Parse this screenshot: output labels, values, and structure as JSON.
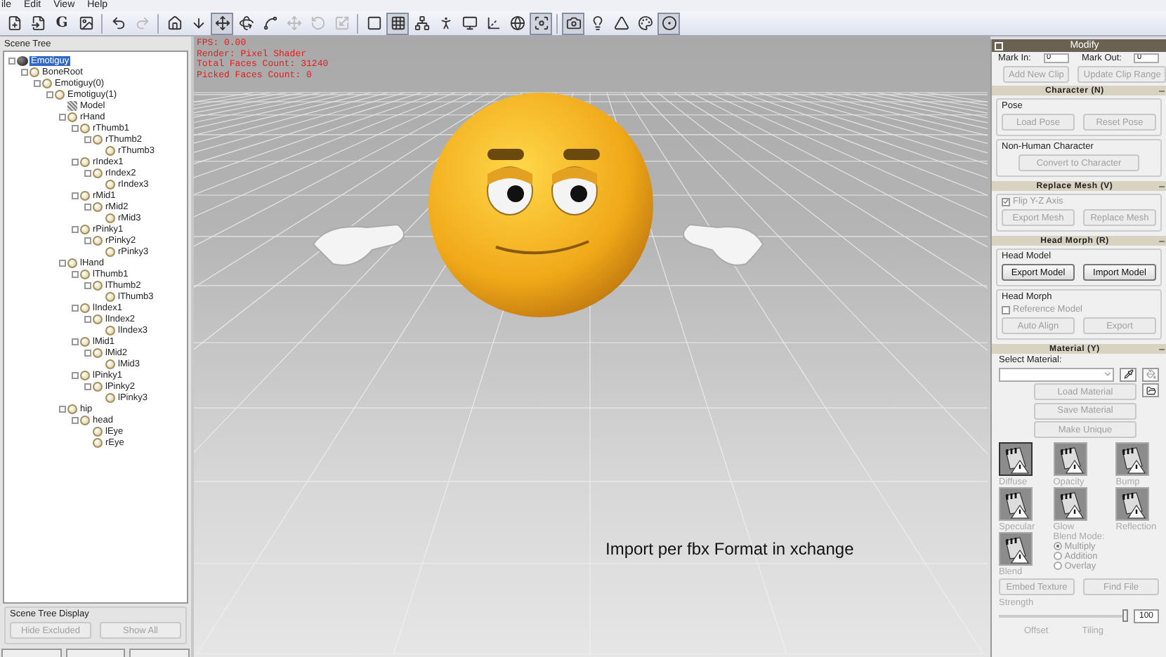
{
  "menu": [
    "ile",
    "Edit",
    "View",
    "Help"
  ],
  "toolbar": [
    {
      "kind": "new",
      "selected": false,
      "disabled": false
    },
    {
      "kind": "open",
      "selected": false,
      "disabled": false
    },
    {
      "kind": "text",
      "label": "G",
      "selected": false,
      "disabled": false
    },
    {
      "kind": "image",
      "selected": false,
      "disabled": false
    },
    {
      "kind": "sep"
    },
    {
      "kind": "undo",
      "selected": false,
      "disabled": false
    },
    {
      "kind": "redo",
      "selected": false,
      "disabled": true
    },
    {
      "kind": "sep"
    },
    {
      "kind": "home",
      "selected": false,
      "disabled": false
    },
    {
      "kind": "down",
      "selected": false,
      "disabled": false
    },
    {
      "kind": "move",
      "selected": true,
      "disabled": false
    },
    {
      "kind": "rotate",
      "selected": false,
      "disabled": false
    },
    {
      "kind": "bend",
      "selected": false,
      "disabled": false
    },
    {
      "kind": "move",
      "selected": false,
      "disabled": true
    },
    {
      "kind": "reset",
      "selected": false,
      "disabled": true
    },
    {
      "kind": "scale",
      "selected": false,
      "disabled": true
    },
    {
      "kind": "sep"
    },
    {
      "kind": "square",
      "selected": false,
      "disabled": false
    },
    {
      "kind": "grid",
      "selected": true,
      "disabled": false
    },
    {
      "kind": "bones",
      "selected": false,
      "disabled": false
    },
    {
      "kind": "figure",
      "selected": false,
      "disabled": false
    },
    {
      "kind": "screen",
      "selected": false,
      "disabled": false
    },
    {
      "kind": "axis",
      "selected": false,
      "disabled": false
    },
    {
      "kind": "globe",
      "selected": false,
      "disabled": false
    },
    {
      "kind": "focus",
      "selected": true,
      "disabled": false
    },
    {
      "kind": "sep"
    },
    {
      "kind": "camera",
      "selected": true,
      "disabled": false
    },
    {
      "kind": "light",
      "selected": false,
      "disabled": false
    },
    {
      "kind": "pyramid",
      "selected": false,
      "disabled": false
    },
    {
      "kind": "color",
      "selected": false,
      "disabled": false
    },
    {
      "kind": "sphere",
      "selected": true,
      "disabled": false
    }
  ],
  "scene_tree": {
    "title": "Scene Tree",
    "items": [
      {
        "label": "Emotiguy",
        "kind": "root",
        "selected": true,
        "children": [
          {
            "label": "BoneRoot",
            "kind": "node",
            "selected": false,
            "children": [
              {
                "label": "Emotiguy(0)",
                "kind": "node",
                "selected": false,
                "children": [
                  {
                    "label": "Emotiguy(1)",
                    "kind": "node",
                    "selected": false,
                    "children": [
                      {
                        "label": "Model",
                        "kind": "model",
                        "selected": false
                      },
                      {
                        "label": "rHand",
                        "kind": "node",
                        "selected": false,
                        "children": [
                          {
                            "label": "rThumb1",
                            "kind": "node",
                            "selected": false,
                            "children": [
                              {
                                "label": "rThumb2",
                                "kind": "node",
                                "selected": false,
                                "children": [
                                  {
                                    "label": "rThumb3",
                                    "kind": "node",
                                    "selected": false
                                  }
                                ]
                              }
                            ]
                          },
                          {
                            "label": "rIndex1",
                            "kind": "node",
                            "selected": false,
                            "children": [
                              {
                                "label": "rIndex2",
                                "kind": "node",
                                "selected": false,
                                "children": [
                                  {
                                    "label": "rIndex3",
                                    "kind": "node",
                                    "selected": false
                                  }
                                ]
                              }
                            ]
                          },
                          {
                            "label": "rMid1",
                            "kind": "node",
                            "selected": false,
                            "children": [
                              {
                                "label": "rMid2",
                                "kind": "node",
                                "selected": false,
                                "children": [
                                  {
                                    "label": "rMid3",
                                    "kind": "node",
                                    "selected": false
                                  }
                                ]
                              }
                            ]
                          },
                          {
                            "label": "rPinky1",
                            "kind": "node",
                            "selected": false,
                            "children": [
                              {
                                "label": "rPinky2",
                                "kind": "node",
                                "selected": false,
                                "children": [
                                  {
                                    "label": "rPinky3",
                                    "kind": "node",
                                    "selected": false
                                  }
                                ]
                              }
                            ]
                          }
                        ]
                      },
                      {
                        "label": "lHand",
                        "kind": "node",
                        "selected": false,
                        "children": [
                          {
                            "label": "lThumb1",
                            "kind": "node",
                            "selected": false,
                            "children": [
                              {
                                "label": "lThumb2",
                                "kind": "node",
                                "selected": false,
                                "children": [
                                  {
                                    "label": "lThumb3",
                                    "kind": "node",
                                    "selected": false
                                  }
                                ]
                              }
                            ]
                          },
                          {
                            "label": "lIndex1",
                            "kind": "node",
                            "selected": false,
                            "children": [
                              {
                                "label": "lIndex2",
                                "kind": "node",
                                "selected": false,
                                "children": [
                                  {
                                    "label": "lIndex3",
                                    "kind": "node",
                                    "selected": false
                                  }
                                ]
                              }
                            ]
                          },
                          {
                            "label": "lMid1",
                            "kind": "node",
                            "selected": false,
                            "children": [
                              {
                                "label": "lMid2",
                                "kind": "node",
                                "selected": false,
                                "children": [
                                  {
                                    "label": "lMid3",
                                    "kind": "node",
                                    "selected": false
                                  }
                                ]
                              }
                            ]
                          },
                          {
                            "label": "lPinky1",
                            "kind": "node",
                            "selected": false,
                            "children": [
                              {
                                "label": "lPinky2",
                                "kind": "node",
                                "selected": false,
                                "children": [
                                  {
                                    "label": "lPinky3",
                                    "kind": "node",
                                    "selected": false
                                  }
                                ]
                              }
                            ]
                          }
                        ]
                      },
                      {
                        "label": "hip",
                        "kind": "node",
                        "selected": false,
                        "children": [
                          {
                            "label": "head",
                            "kind": "node",
                            "selected": false,
                            "children": [
                              {
                                "label": "lEye",
                                "kind": "node",
                                "selected": false
                              },
                              {
                                "label": "rEye",
                                "kind": "node",
                                "selected": false
                              }
                            ]
                          }
                        ]
                      }
                    ]
                  }
                ]
              }
            ]
          }
        ]
      }
    ]
  },
  "scene_tree_display": {
    "title": "Scene Tree Display",
    "buttons": [
      {
        "label": "Hide Excluded",
        "disabled": true
      },
      {
        "label": "Show All",
        "disabled": true
      }
    ]
  },
  "viewport": {
    "stats": [
      "FPS: 0.00",
      "Render: Pixel Shader",
      "Total Faces Count: 31240",
      "Picked Faces Count: 0"
    ],
    "caption": "Import per fbx Format in xchange"
  },
  "modify": {
    "title": "Modify",
    "mark_in": {
      "label": "Mark In:",
      "value": "0"
    },
    "mark_out": {
      "label": "Mark Out:",
      "value": "0"
    },
    "clip_buttons": [
      {
        "label": "Add New Clip",
        "disabled": true
      },
      {
        "label": "Update Clip Range",
        "disabled": true
      }
    ],
    "sections": [
      {
        "title": "Character (N)",
        "groups": [
          {
            "title": "Pose",
            "rows": [
              {
                "kind": "buttons",
                "buttons": [
                  {
                    "label": "Load Pose",
                    "disabled": true
                  },
                  {
                    "label": "Reset Pose",
                    "disabled": true
                  }
                ]
              }
            ]
          },
          {
            "title": "Non-Human Character",
            "rows": [
              {
                "kind": "wide",
                "buttons": [
                  {
                    "label": "Convert to Character",
                    "disabled": true
                  }
                ]
              }
            ]
          }
        ]
      },
      {
        "title": "Replace Mesh (V)",
        "groups": [
          {
            "rows": [
              {
                "kind": "checkbox",
                "label": "Flip Y-Z Axis",
                "checked": true,
                "disabled": true
              },
              {
                "kind": "buttons",
                "buttons": [
                  {
                    "label": "Export Mesh",
                    "disabled": true
                  },
                  {
                    "label": "Replace Mesh",
                    "disabled": true
                  }
                ]
              }
            ]
          }
        ]
      },
      {
        "title": "Head Morph (R)",
        "groups": [
          {
            "title": "Head Model",
            "rows": [
              {
                "kind": "buttons",
                "buttons": [
                  {
                    "label": "Export Model",
                    "disabled": false
                  },
                  {
                    "label": "Import Model",
                    "disabled": false
                  }
                ]
              }
            ]
          },
          {
            "title": "Head Morph",
            "rows": [
              {
                "kind": "checkbox",
                "label": "Reference Model",
                "checked": false,
                "disabled": true
              },
              {
                "kind": "buttons",
                "buttons": [
                  {
                    "label": "Auto Align",
                    "disabled": true
                  },
                  {
                    "label": "Export",
                    "disabled": true
                  }
                ]
              }
            ]
          }
        ]
      }
    ],
    "material": {
      "title": "Material (Y)",
      "select_label": "Select Material:",
      "buttons": [
        {
          "label": "Load Material",
          "disabled": true
        },
        {
          "label": "Save Material",
          "disabled": true
        },
        {
          "label": "Make Unique",
          "disabled": true
        }
      ],
      "channels": [
        {
          "label": "Diffuse",
          "selected": true
        },
        {
          "label": "Opacity",
          "selected": false
        },
        {
          "label": "Bump",
          "selected": false
        },
        {
          "label": "Specular",
          "selected": false
        },
        {
          "label": "Glow",
          "selected": false
        },
        {
          "label": "Reflection",
          "selected": false
        },
        {
          "label": "Blend",
          "selected": false
        }
      ],
      "blend_mode": {
        "label": "Blend Mode:",
        "options": [
          {
            "label": "Multiply",
            "selected": true
          },
          {
            "label": "Addition",
            "selected": false
          },
          {
            "label": "Overlay",
            "selected": false
          }
        ]
      },
      "bottom_buttons": [
        {
          "label": "Embed Texture",
          "disabled": true
        },
        {
          "label": "Find File",
          "disabled": true
        }
      ],
      "strength": {
        "label": "Strength",
        "level": 1,
        "reading": "100"
      },
      "footer_labels": [
        "Offset",
        "Tiling"
      ]
    }
  }
}
